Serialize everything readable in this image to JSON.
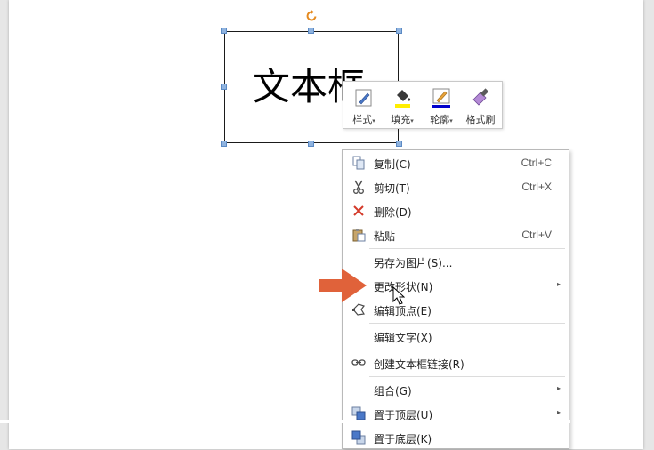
{
  "canvas": {
    "textbox_text": "文本框"
  },
  "mini_toolbar": {
    "items": [
      {
        "label": "样式",
        "icon": "style-icon",
        "has_dropdown": true
      },
      {
        "label": "填充",
        "icon": "fill-bucket-icon",
        "has_dropdown": true
      },
      {
        "label": "轮廓",
        "icon": "outline-pen-icon",
        "has_dropdown": true
      },
      {
        "label": "格式刷",
        "icon": "format-painter-icon",
        "has_dropdown": false
      }
    ],
    "colors": {
      "fill": "#ffee00",
      "outline": "#0000cc"
    }
  },
  "context_menu": {
    "items": [
      {
        "label": "复制(C)",
        "shortcut": "Ctrl+C",
        "icon": "copy-icon"
      },
      {
        "label": "剪切(T)",
        "shortcut": "Ctrl+X",
        "icon": "scissors-icon"
      },
      {
        "label": "删除(D)",
        "shortcut": "",
        "icon": "delete-x-icon"
      },
      {
        "label": "粘贴",
        "shortcut": "Ctrl+V",
        "icon": "paste-icon"
      },
      {
        "label": "另存为图片(S)...",
        "shortcut": "",
        "icon": ""
      },
      {
        "label": "更改形状(N)",
        "shortcut": "",
        "icon": "",
        "submenu": true
      },
      {
        "label": "编辑顶点(E)",
        "shortcut": "",
        "icon": "edit-points-icon"
      },
      {
        "label": "编辑文字(X)",
        "shortcut": "",
        "icon": ""
      },
      {
        "label": "创建文本框链接(R)",
        "shortcut": "",
        "icon": "link-icon"
      },
      {
        "label": "组合(G)",
        "shortcut": "",
        "icon": "",
        "submenu": true
      },
      {
        "label": "置于顶层(U)",
        "shortcut": "",
        "icon": "bring-to-front-icon",
        "submenu": true
      },
      {
        "label": "置于底层(K)",
        "shortcut": "",
        "icon": "send-to-back-icon"
      }
    ],
    "submenu_arrow": "▸",
    "accent_color": "#e0623a"
  },
  "dropdown_caret": "▾"
}
